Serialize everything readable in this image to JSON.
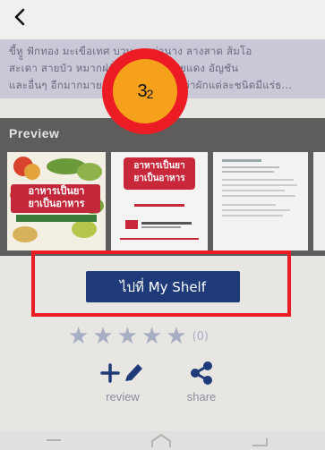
{
  "header": {
    "back_icon": "back-chevron-icon"
  },
  "description": {
    "lines": [
      "ขี้หูู ฟักทอง มะเขือเทศ บวบ ยอ ย่านาง ลางสาด ส้มโอ",
      "สะเดา สายบัว หมากฝรั่ง อ้อย องุ่น อ้อยแดง อัญชัน",
      "และอื่นๆ อีกมากมาย ที่จะทำให้คุณเห็นว่าผักแต่ละชนิดมีแร่ธ..."
    ]
  },
  "annotation": {
    "badge_number": "3",
    "badge_sub": "2"
  },
  "preview": {
    "title": "Preview",
    "cover_title_line1": "อาหารเป็นยา",
    "cover_title_line2": "ยาเป็นอาหาร",
    "page2_line1": "อาหารเป็นยา",
    "page2_line2": "ยาเป็นอาหาร"
  },
  "actions": {
    "shelf_button_label": "ไปที่ My Shelf",
    "rating_count": "(0)",
    "review_label": "review",
    "share_label": "share"
  },
  "colors": {
    "accent_red": "#ec1c24",
    "button_blue": "#1e3a78",
    "badge_orange": "#f6a11b"
  }
}
